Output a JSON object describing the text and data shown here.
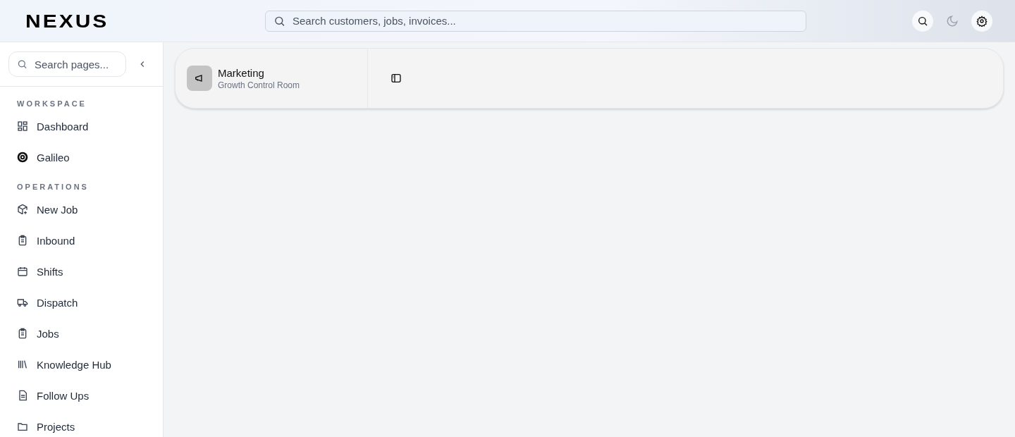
{
  "header": {
    "logo": "NEXUS",
    "search": {
      "placeholder": "Search customers, jobs, invoices..."
    },
    "actions": [
      {
        "kind": "search"
      },
      {
        "kind": "theme"
      },
      {
        "kind": "settings"
      }
    ]
  },
  "sidebar": {
    "search": {
      "placeholder": "Search pages..."
    },
    "sections": [
      {
        "title": "WORKSPACE",
        "items": [
          {
            "label": "Dashboard"
          },
          {
            "label": "Galileo"
          }
        ]
      },
      {
        "title": "OPERATIONS",
        "items": [
          {
            "label": "New Job"
          },
          {
            "label": "Inbound"
          },
          {
            "label": "Shifts"
          },
          {
            "label": "Dispatch"
          },
          {
            "label": "Jobs"
          },
          {
            "label": "Knowledge Hub"
          },
          {
            "label": "Follow Ups"
          },
          {
            "label": "Projects"
          }
        ]
      }
    ]
  },
  "panel": {
    "title": "Marketing",
    "subtitle": "Growth Control Room"
  }
}
